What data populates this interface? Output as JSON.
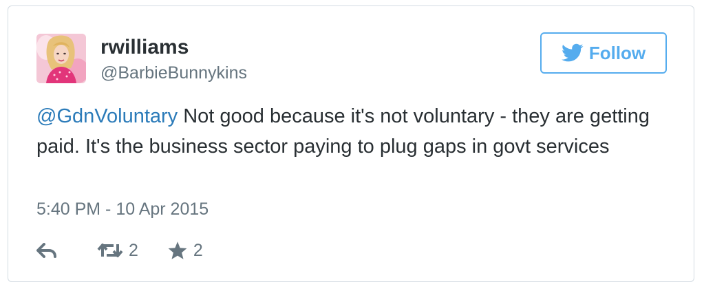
{
  "user": {
    "name": "rwilliams",
    "handle": "@BarbieBunnykins"
  },
  "follow": {
    "label": "Follow",
    "icon": "twitter-bird-icon"
  },
  "tweet": {
    "mention": "@GdnVoluntary",
    "body": " Not good because it's not voluntary - they are getting paid. It's the business sector paying to plug gaps in govt services",
    "timestamp": "5:40 PM - 10 Apr 2015"
  },
  "actions": {
    "reply_icon": "reply-icon",
    "retweet_icon": "retweet-icon",
    "retweet_count": "2",
    "favorite_icon": "star-icon",
    "favorite_count": "2"
  },
  "colors": {
    "brand": "#55acee",
    "link": "#2b7bb9",
    "text": "#292f33",
    "muted": "#66757f",
    "border": "#d3dbe2"
  }
}
